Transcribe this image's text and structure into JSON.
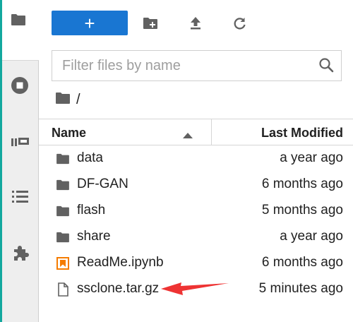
{
  "toolbar": {
    "new_label": "+"
  },
  "filter": {
    "placeholder": "Filter files by name",
    "value": ""
  },
  "breadcrumb": {
    "path": "/"
  },
  "columns": {
    "name": "Name",
    "modified": "Last Modified"
  },
  "files": [
    {
      "name": "data",
      "modified": "a year ago",
      "icon": "folder-icon"
    },
    {
      "name": "DF-GAN",
      "modified": "6 months ago",
      "icon": "folder-icon"
    },
    {
      "name": "flash",
      "modified": "5 months ago",
      "icon": "folder-icon"
    },
    {
      "name": "share",
      "modified": "a year ago",
      "icon": "folder-icon"
    },
    {
      "name": "ReadMe.ipynb",
      "modified": "6 months ago",
      "icon": "notebook-icon"
    },
    {
      "name": "ssclone.tar.gz",
      "modified": "5 minutes ago",
      "icon": "file-icon"
    }
  ],
  "colors": {
    "accent": "#1976d2",
    "teal_edge": "#13a89e",
    "notebook_orange": "#f57c00",
    "annotation_arrow": "#ee3333"
  }
}
